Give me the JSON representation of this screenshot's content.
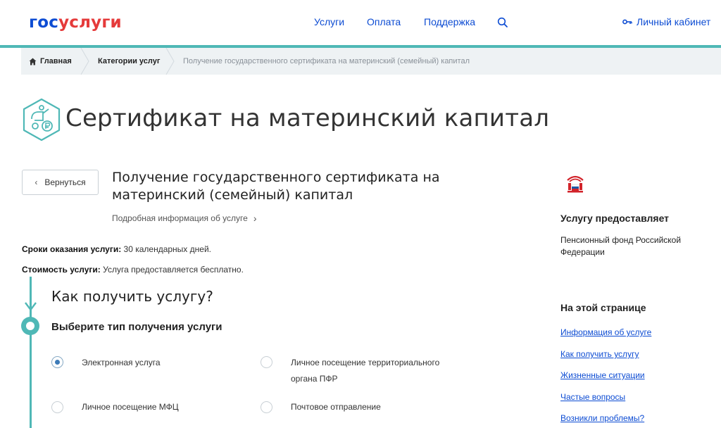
{
  "header": {
    "logo_gos": "гос",
    "logo_uslugi": "услуги",
    "nav": {
      "services": "Услуги",
      "payment": "Оплата",
      "support": "Поддержка"
    },
    "cabinet": "Личный кабинет",
    "accent_color": "#0d4cd3",
    "teal_color": "#4fb8b6"
  },
  "breadcrumb": {
    "home": "Главная",
    "categories": "Категории услуг",
    "current": "Получение государственного сертификата на материнский (семейный) капитал"
  },
  "page_title": "Сертификат на материнский капитал",
  "back_button": "Вернуться",
  "service": {
    "title": "Получение государственного сертификата на материнский (семейный) капитал",
    "detail_link": "Подробная информация об услуге",
    "terms_label": "Сроки оказания услуги:",
    "terms_value": " 30 календарных дней.",
    "cost_label": "Стоимость услуги:",
    "cost_value": " Услуга предоставляется бесплатно."
  },
  "steps": {
    "how_title": "Как получить услугу?",
    "choose_title": "Выберите тип получения услуги",
    "options": [
      {
        "label": "Электронная услуга",
        "selected": true
      },
      {
        "label_line1": "Личное посещение территориального",
        "label_line2": "органа ПФР",
        "selected": false
      },
      {
        "label": "Личное посещение МФЦ",
        "selected": false
      },
      {
        "label": "Почтовое отправление",
        "selected": false
      }
    ]
  },
  "sidebar": {
    "provider_title": "Услугу предоставляет",
    "provider_name": "Пенсионный фонд Российской Федерации",
    "onpage_title": "На этой странице",
    "links": [
      "Информация об услуге",
      "Как получить услугу",
      "Жизненные ситуации",
      "Частые вопросы",
      "Возникли проблемы?"
    ]
  }
}
